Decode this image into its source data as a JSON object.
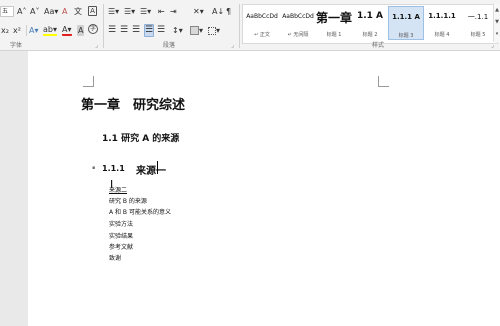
{
  "ribbon": {
    "font_group_label": "字体",
    "paragraph_group_label": "段落",
    "styles_group_label": "样式",
    "font": {
      "size_box": "五",
      "grow": "A˄",
      "shrink": "A˅",
      "change_case": "Aa▾",
      "clear_format": "A",
      "phonetic": "文",
      "char_border": "A",
      "subscript": "x₂",
      "superscript": "x²",
      "text_effects": "A▾",
      "highlight": "ab▾",
      "font_color": "A▾",
      "char_shading": "A",
      "enclose": "字"
    },
    "paragraph": {
      "bullets": "☰▾",
      "numbering": "☰▾",
      "multilevel": "☰▾",
      "decrease_indent": "⇤",
      "increase_indent": "⇥",
      "chinese_layout": "✕▾",
      "sort": "A↓",
      "show_marks": "¶",
      "line_spacing": "↕▾",
      "shading": "▾",
      "borders": "▾"
    },
    "styles": [
      {
        "sample": "AaBbCcDd",
        "name": "↵ 正文"
      },
      {
        "sample": "AaBbCcDd",
        "name": "↵ 无间隔"
      },
      {
        "sample": "第一章",
        "name": "标题 1"
      },
      {
        "sample": "1.1  A",
        "name": "标题 2"
      },
      {
        "sample": "1.1.1  A",
        "name": "标题 3"
      },
      {
        "sample": "1.1.1.1",
        "name": "标题 4"
      },
      {
        "sample": "一.1.1",
        "name": "标题 5"
      }
    ],
    "active_style_index": 4
  },
  "document": {
    "heading1": "第一章　研究综述",
    "heading2": "1.1  研究 A 的来源",
    "heading3_number": "1.1.1",
    "heading3_text": "来源一",
    "body_lines": [
      "来源二",
      "研究 B 的来源",
      "A 和 B 可能关系的意义",
      "实验方法",
      "实验结果",
      "参考文献",
      "致谢"
    ]
  }
}
